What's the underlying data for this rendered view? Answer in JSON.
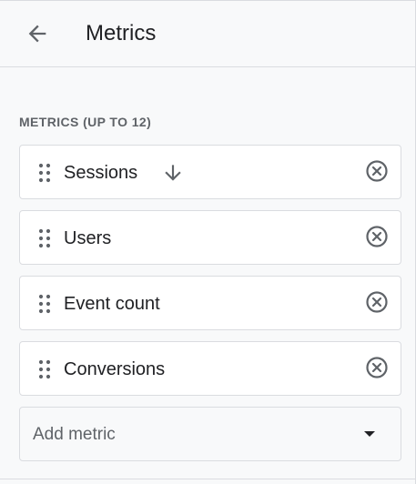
{
  "header": {
    "title": "Metrics",
    "back_icon": "arrow-back-icon"
  },
  "section": {
    "label": "METRICS (UP TO 12)"
  },
  "metrics": [
    {
      "label": "Sessions",
      "drag_icon": "drag-handle-icon",
      "sort_icon": "arrow-down-icon",
      "remove_icon": "close-circle-icon"
    },
    {
      "label": "Users",
      "drag_icon": "drag-handle-icon",
      "remove_icon": "close-circle-icon"
    },
    {
      "label": "Event count",
      "drag_icon": "drag-handle-icon",
      "remove_icon": "close-circle-icon"
    },
    {
      "label": "Conversions",
      "drag_icon": "drag-handle-icon",
      "remove_icon": "close-circle-icon"
    }
  ],
  "add_metric": {
    "placeholder": "Add metric",
    "dropdown_icon": "dropdown-arrow-icon"
  },
  "colors": {
    "background": "#f8f9fa",
    "surface": "#ffffff",
    "border": "#dadce0",
    "text_primary": "#202124",
    "text_secondary": "#5f6368"
  }
}
